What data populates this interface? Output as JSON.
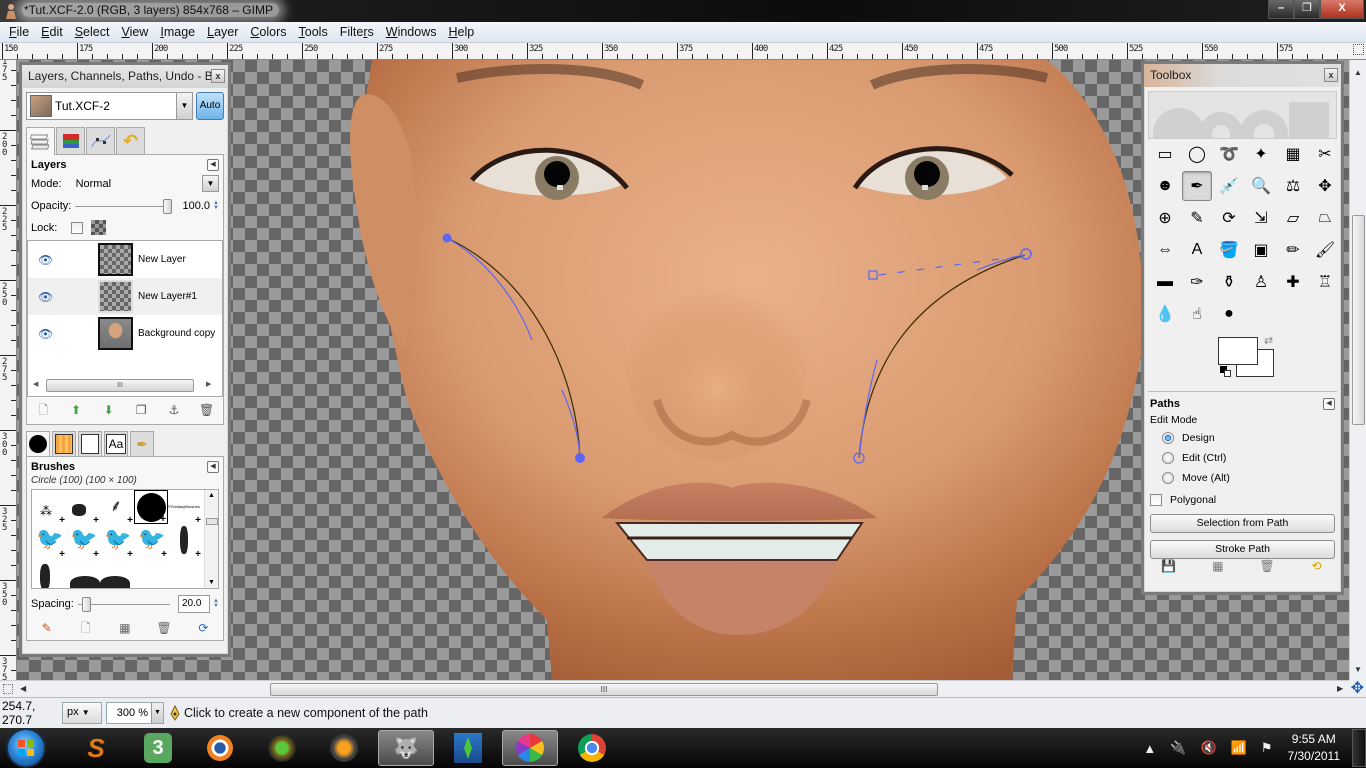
{
  "window": {
    "title": "*Tut.XCF-2.0 (RGB, 3 layers) 854x768 – GIMP",
    "controls": [
      "minimize",
      "restore",
      "close"
    ]
  },
  "menubar": {
    "items": [
      {
        "label": "File",
        "mnemonic": "F"
      },
      {
        "label": "Edit",
        "mnemonic": "E"
      },
      {
        "label": "Select",
        "mnemonic": "S"
      },
      {
        "label": "View",
        "mnemonic": "V"
      },
      {
        "label": "Image",
        "mnemonic": "I"
      },
      {
        "label": "Layer",
        "mnemonic": "L"
      },
      {
        "label": "Colors",
        "mnemonic": "C"
      },
      {
        "label": "Tools",
        "mnemonic": "T"
      },
      {
        "label": "Filters",
        "mnemonic": "r"
      },
      {
        "label": "Windows",
        "mnemonic": "W"
      },
      {
        "label": "Help",
        "mnemonic": "H"
      }
    ]
  },
  "rulers": {
    "horizontal_labels": [
      "150",
      "175",
      "200",
      "225",
      "250",
      "275",
      "300",
      "325",
      "350",
      "375",
      "400",
      "425",
      "450",
      "475",
      "500",
      "525",
      "550",
      "575"
    ],
    "vertical_labels": [
      "175",
      "200",
      "225",
      "250",
      "275",
      "300",
      "325",
      "350",
      "375"
    ]
  },
  "layers_dock": {
    "title": "Layers, Channels, Paths, Undo - B...",
    "image_name": "Tut.XCF-2",
    "auto_label": "Auto",
    "tabs": [
      "layers-tab",
      "channels-tab",
      "paths-tab",
      "undo-tab"
    ],
    "layers_panel": {
      "title": "Layers",
      "mode_label": "Mode:",
      "mode_value": "Normal",
      "opacity_label": "Opacity:",
      "opacity_value": "100.0",
      "opacity_fraction": 1.0,
      "lock_label": "Lock:",
      "layers": [
        {
          "name": "New Layer",
          "visible": true,
          "selected": false
        },
        {
          "name": "New Layer#1",
          "visible": true,
          "selected": true
        },
        {
          "name": "Background copy",
          "visible": true,
          "selected": false
        }
      ],
      "buttons": [
        "new-layer",
        "raise-layer",
        "lower-layer",
        "duplicate-layer",
        "anchor-layer",
        "delete-layer"
      ]
    },
    "bottom_tabs": [
      "brushes-tab",
      "patterns-tab",
      "gradients-tab",
      "fonts-tab",
      "tool-options-tab"
    ],
    "fonts_tab_label": "Aa",
    "brushes_panel": {
      "title": "Brushes",
      "selected_brush": "Circle (100) (100 × 100)",
      "spacing_label": "Spacing:",
      "spacing_value": "20.0",
      "spacing_fraction": 0.2,
      "brush_caption": "©FantasyBrushes",
      "buttons": [
        "edit-brush",
        "new-brush",
        "duplicate-brush",
        "delete-brush",
        "refresh-brushes"
      ]
    }
  },
  "toolbox": {
    "title": "Toolbox",
    "tools": [
      {
        "name": "rect-select",
        "glyph": "▭"
      },
      {
        "name": "ellipse-select",
        "glyph": "◯"
      },
      {
        "name": "free-select",
        "glyph": "➰"
      },
      {
        "name": "fuzzy-select",
        "glyph": "✦"
      },
      {
        "name": "select-by-color",
        "glyph": "▦"
      },
      {
        "name": "scissors-select",
        "glyph": "✂"
      },
      {
        "name": "foreground-select",
        "glyph": "☻"
      },
      {
        "name": "paths",
        "glyph": "✒",
        "active": true
      },
      {
        "name": "color-picker",
        "glyph": "💉"
      },
      {
        "name": "zoom",
        "glyph": "🔍"
      },
      {
        "name": "measure",
        "glyph": "⚖"
      },
      {
        "name": "move",
        "glyph": "✥"
      },
      {
        "name": "align",
        "glyph": "⊕"
      },
      {
        "name": "crop",
        "glyph": "✎"
      },
      {
        "name": "rotate",
        "glyph": "⟳"
      },
      {
        "name": "scale",
        "glyph": "⇲"
      },
      {
        "name": "shear",
        "glyph": "▱"
      },
      {
        "name": "perspective",
        "glyph": "⏢"
      },
      {
        "name": "flip",
        "glyph": "⇔"
      },
      {
        "name": "text",
        "glyph": "A"
      },
      {
        "name": "bucket-fill",
        "glyph": "🪣"
      },
      {
        "name": "blend",
        "glyph": "▣"
      },
      {
        "name": "pencil",
        "glyph": "✏"
      },
      {
        "name": "paintbrush",
        "glyph": "🖌"
      },
      {
        "name": "eraser",
        "glyph": "▬"
      },
      {
        "name": "airbrush",
        "glyph": "✑"
      },
      {
        "name": "ink",
        "glyph": "⚱"
      },
      {
        "name": "clone",
        "glyph": "♙"
      },
      {
        "name": "heal",
        "glyph": "✚"
      },
      {
        "name": "perspective-clone",
        "glyph": "♖"
      },
      {
        "name": "blur-sharpen",
        "glyph": "💧"
      },
      {
        "name": "smudge",
        "glyph": "☝"
      },
      {
        "name": "dodge-burn",
        "glyph": "●"
      }
    ],
    "foreground_color": "#ffffff",
    "background_color": "#ffffff",
    "paths_options": {
      "title": "Paths",
      "edit_mode_label": "Edit Mode",
      "modes": [
        {
          "label": "Design",
          "checked": true
        },
        {
          "label": "Edit (Ctrl)",
          "checked": false
        },
        {
          "label": "Move (Alt)",
          "checked": false
        }
      ],
      "polygonal_label": "Polygonal",
      "polygonal_checked": false,
      "selection_from_path": "Selection from Path",
      "stroke_path": "Stroke Path",
      "buttons": [
        "save-options",
        "restore-options",
        "delete-options",
        "reset-options"
      ]
    }
  },
  "canvas": {
    "path_color": "#5b66f5",
    "path_stroke_color": "#3a2a00"
  },
  "statusbar": {
    "coordinates": "254.7, 270.7",
    "unit": "px",
    "zoom": "300 %",
    "message": "Click to create a new component of the path"
  },
  "taskbar": {
    "apps": [
      {
        "name": "start-button"
      },
      {
        "name": "app-s",
        "label": "S"
      },
      {
        "name": "app-3",
        "label": "3"
      },
      {
        "name": "blender"
      },
      {
        "name": "sims-launcher"
      },
      {
        "name": "fl-studio"
      },
      {
        "name": "gimp",
        "active": true
      },
      {
        "name": "sims"
      },
      {
        "name": "picasa",
        "active": true
      },
      {
        "name": "chrome"
      }
    ],
    "time": "9:55 AM",
    "date": "7/30/2011"
  }
}
